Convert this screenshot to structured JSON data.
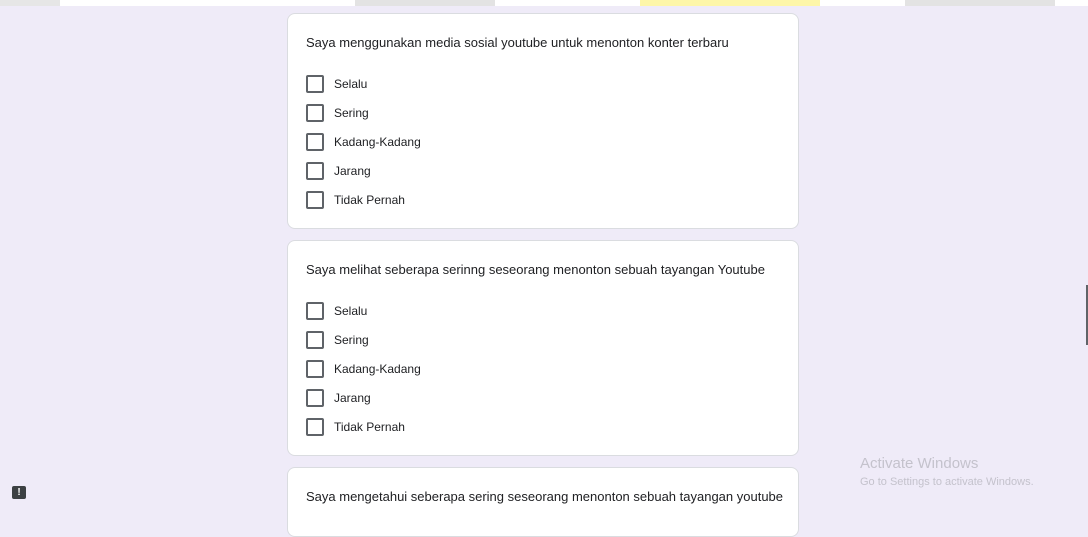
{
  "colors": {
    "page_background": "#efebf8",
    "card_background": "#ffffff",
    "card_border": "#dadce0",
    "checkbox_border": "#5f6368",
    "text": "#202124",
    "watermark": "#c4c2cc",
    "top_strip_accent": "#fdf6a8",
    "top_strip_gray": "#e0e0e0"
  },
  "questions": [
    {
      "title": "Saya menggunakan media sosial youtube untuk menonton konter terbaru",
      "options": [
        "Selalu",
        "Sering",
        "Kadang-Kadang",
        "Jarang",
        "Tidak Pernah"
      ]
    },
    {
      "title": "Saya melihat seberapa serinng seseorang menonton sebuah tayangan Youtube",
      "options": [
        "Selalu",
        "Sering",
        "Kadang-Kadang",
        "Jarang",
        "Tidak Pernah"
      ]
    },
    {
      "title": "Saya mengetahui seberapa sering seseorang menonton sebuah tayangan youtube",
      "options": []
    }
  ],
  "feedback": {
    "icon": "report-icon",
    "glyph": "!"
  },
  "watermark": {
    "title": "Activate Windows",
    "subtitle": "Go to Settings to activate Windows."
  }
}
